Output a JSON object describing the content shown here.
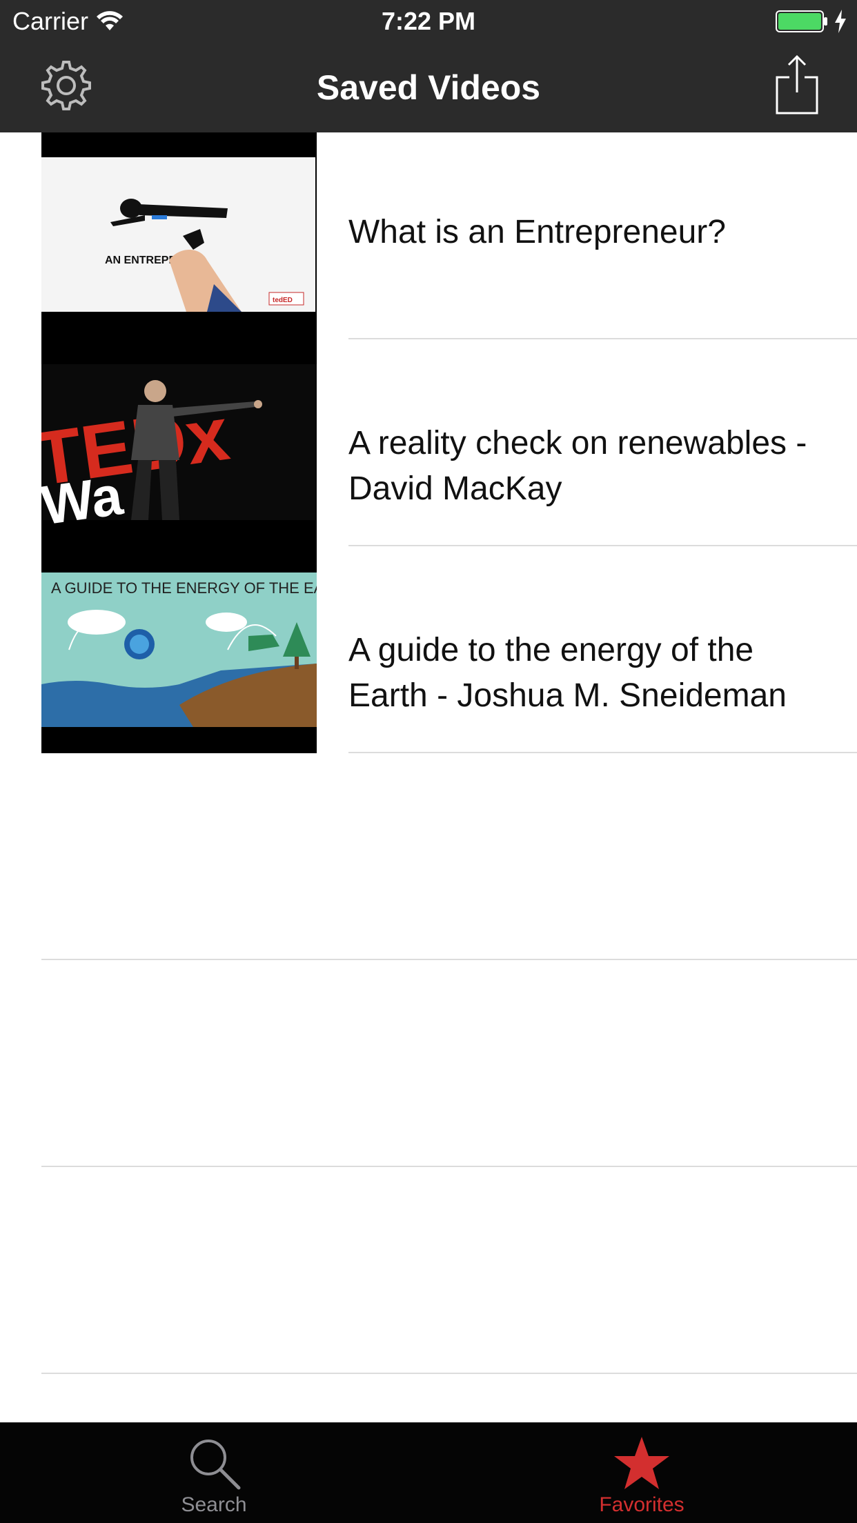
{
  "status_bar": {
    "carrier": "Carrier",
    "time": "7:22 PM",
    "wifi_icon": "wifi-icon",
    "battery_icon": "battery-full-icon",
    "charging_icon": "bolt-icon",
    "battery_color": "#4cd964"
  },
  "nav": {
    "title": "Saved Videos",
    "left_icon": "gear-icon",
    "right_icon": "share-icon"
  },
  "videos": [
    {
      "title": "What is an Entrepreneur?",
      "thumb_text": "AN ENTREPRE"
    },
    {
      "title": "A reality check on renewables - David MacKay",
      "thumb_text": "TEDx"
    },
    {
      "title": "A guide to the energy of the Earth - Joshua M. Sneideman",
      "thumb_text": "A GUIDE TO THE ENERGY OF THE EARTH"
    }
  ],
  "tabs": [
    {
      "label": "Search",
      "icon": "search-icon",
      "selected": false
    },
    {
      "label": "Favorites",
      "icon": "star-icon",
      "selected": true
    }
  ],
  "colors": {
    "bar_background": "#2b2b2b",
    "tab_bar_background": "#050505",
    "accent": "#d32f2f"
  }
}
